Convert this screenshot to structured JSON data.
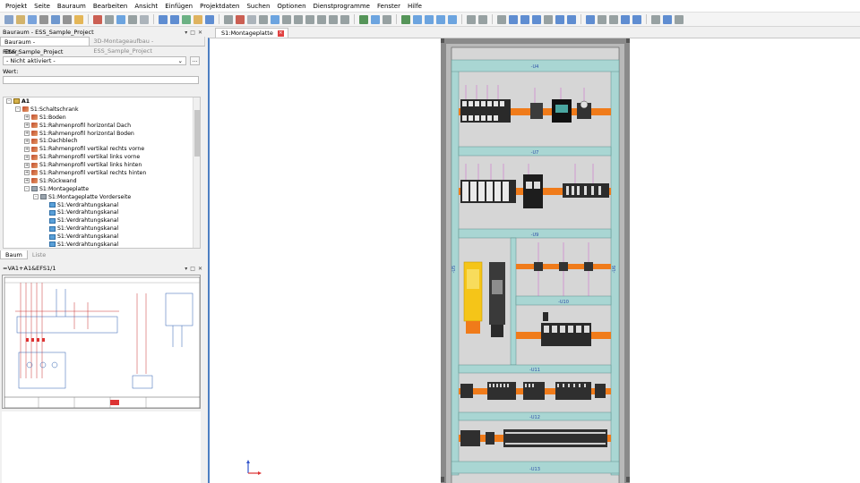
{
  "menu": [
    "Projekt",
    "Seite",
    "Bauraum",
    "Bearbeiten",
    "Ansicht",
    "Einfügen",
    "Projektdaten",
    "Suchen",
    "Optionen",
    "Dienstprogramme",
    "Fenster",
    "Hilfe"
  ],
  "left_panel": {
    "title": "Bauraum - ESS_Sample_Project",
    "tabs": [
      "Bauraum - ESS_Sample_Project",
      "3D-Montageaufbau - ESS_Sample_Project"
    ],
    "filter_label": "Filter:",
    "filter_value": "- Nicht aktiviert -",
    "filter_more": "...",
    "value_label": "Wert:",
    "tree": [
      {
        "label": "A1",
        "level": 0,
        "exp": "-",
        "icon": "root"
      },
      {
        "label": "S1:Schaltschrank",
        "level": 1,
        "exp": "-",
        "icon": "red"
      },
      {
        "label": "S1:Boden",
        "level": 2,
        "exp": "+",
        "icon": "red"
      },
      {
        "label": "S1:Rahmenprofil horizontal Dach",
        "level": 2,
        "exp": "+",
        "icon": "red"
      },
      {
        "label": "S1:Rahmenprofil horizontal Boden",
        "level": 2,
        "exp": "+",
        "icon": "red"
      },
      {
        "label": "S1:Dachblech",
        "level": 2,
        "exp": "+",
        "icon": "red"
      },
      {
        "label": "S1:Rahmenprofil vertikal rechts vorne",
        "level": 2,
        "exp": "+",
        "icon": "red"
      },
      {
        "label": "S1:Rahmenprofil vertikal links vorne",
        "level": 2,
        "exp": "+",
        "icon": "red"
      },
      {
        "label": "S1:Rahmenprofil vertikal links hinten",
        "level": 2,
        "exp": "+",
        "icon": "red"
      },
      {
        "label": "S1:Rahmenprofil vertikal rechts hinten",
        "level": 2,
        "exp": "+",
        "icon": "red"
      },
      {
        "label": "S1:Rückwand",
        "level": 2,
        "exp": "+",
        "icon": "red"
      },
      {
        "label": "S1:Montageplatte",
        "level": 2,
        "exp": "-",
        "icon": "gray"
      },
      {
        "label": "S1:Montageplatte Vorderseite",
        "level": 3,
        "exp": "-",
        "icon": "gray"
      },
      {
        "label": "S1:Verdrahtungskanal",
        "level": 4,
        "exp": "",
        "icon": "blue"
      },
      {
        "label": "S1:Verdrahtungskanal",
        "level": 4,
        "exp": "",
        "icon": "blue"
      },
      {
        "label": "S1:Verdrahtungskanal",
        "level": 4,
        "exp": "",
        "icon": "blue"
      },
      {
        "label": "S1:Verdrahtungskanal",
        "level": 4,
        "exp": "",
        "icon": "blue"
      },
      {
        "label": "S1:Verdrahtungskanal",
        "level": 4,
        "exp": "",
        "icon": "blue"
      },
      {
        "label": "S1:Verdrahtungskanal",
        "level": 4,
        "exp": "",
        "icon": "blue"
      }
    ],
    "bottom_tabs": [
      "Baum",
      "Liste"
    ]
  },
  "preview_panel": {
    "title": "=VA1+A1&EFS1/1"
  },
  "document": {
    "tab_label": "S1:Montageplatte",
    "tab_close": "×"
  },
  "cabinet": {
    "rail_labels": [
      "-U4",
      "-U7",
      "-U9",
      "-U10",
      "-U11",
      "-U12",
      "-U13"
    ],
    "side_labels": [
      "-U5",
      "-U6"
    ]
  },
  "colors": {
    "accent": "#4d7fc2",
    "rail": "#f07b1a",
    "duct": "#a9d6d3",
    "plate": "#d9d9d9",
    "frame": "#7b7b7b",
    "yellow_component": "#f5c518"
  }
}
